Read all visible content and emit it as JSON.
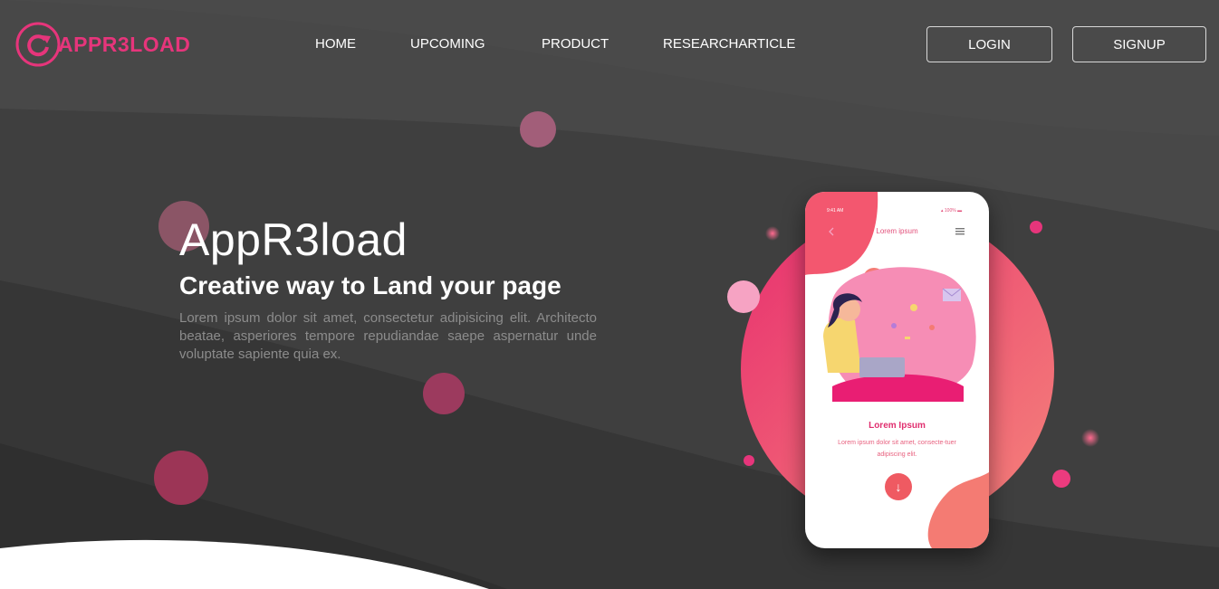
{
  "brand": {
    "logo_text": "APPR3LOAD",
    "accent_color": "#e6357b"
  },
  "nav": {
    "items": [
      {
        "label": "HOME"
      },
      {
        "label": "UPCOMING"
      },
      {
        "label": "PRODUCT"
      },
      {
        "label": "RESEARCHARTICLE"
      }
    ]
  },
  "auth": {
    "login_label": "LOGIN",
    "signup_label": "SIGNUP"
  },
  "hero": {
    "title": "AppR3load",
    "subtitle": "Creative way to Land your page",
    "description": "Lorem ipsum dolor sit amet, consectetur adipisicing elit. Architecto beatae, asperiores tempore repudiandae saepe aspernatur unde voluptate sapiente quia ex."
  },
  "phone": {
    "status_time": "9:41 AM",
    "status_battery": "▴ 100% ▬",
    "header_title": "Lorem ipsum",
    "back_icon": "chevron-left-icon",
    "menu_icon": "hamburger-menu-icon",
    "card_title": "Lorem Ipsum",
    "card_text": "Lorem ipsum dolor sit amet, consecte-tuer adipiscing elit.",
    "down_icon": "arrow-down-icon",
    "down_glyph": "↓"
  },
  "colors": {
    "background": "#3f3f3f",
    "pink": "#e6357b",
    "coral": "#f47b73"
  }
}
